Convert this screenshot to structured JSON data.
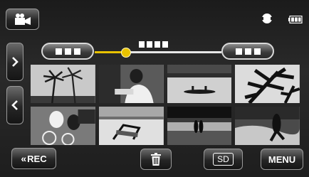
{
  "header": {
    "mode_icon": "video-camera-icon",
    "media_icon": "memory-card-icon",
    "battery_icon": "battery-icon"
  },
  "navigation": {
    "date_prev_icon": "date-previous-indicator",
    "date_next_icon": "date-next-indicator",
    "scrubber_position": 0.24,
    "page_next_icon": "chevron-right-icon",
    "page_prev_icon": "chevron-left-icon"
  },
  "thumbnails": [
    {
      "subject": "palm-trees",
      "row": 1,
      "col": 1
    },
    {
      "subject": "person-reading",
      "row": 1,
      "col": 2
    },
    {
      "subject": "canoe-on-lake",
      "row": 1,
      "col": 3
    },
    {
      "subject": "palm-leaves",
      "row": 1,
      "col": 4
    },
    {
      "subject": "cyclists",
      "row": 2,
      "col": 1
    },
    {
      "subject": "beach-chair",
      "row": 2,
      "col": 2
    },
    {
      "subject": "couple-at-sunset",
      "row": 2,
      "col": 3
    },
    {
      "subject": "runner-on-beach",
      "row": 2,
      "col": 4
    }
  ],
  "footer": {
    "playback_label": "REC",
    "playback_icon": "double-chevron-left-icon",
    "delete_icon": "trash-icon",
    "storage_label": "SD",
    "menu_label": "MENU"
  },
  "colors": {
    "scrubber_marker": "#e8c200",
    "background": "#1e1e1e"
  }
}
